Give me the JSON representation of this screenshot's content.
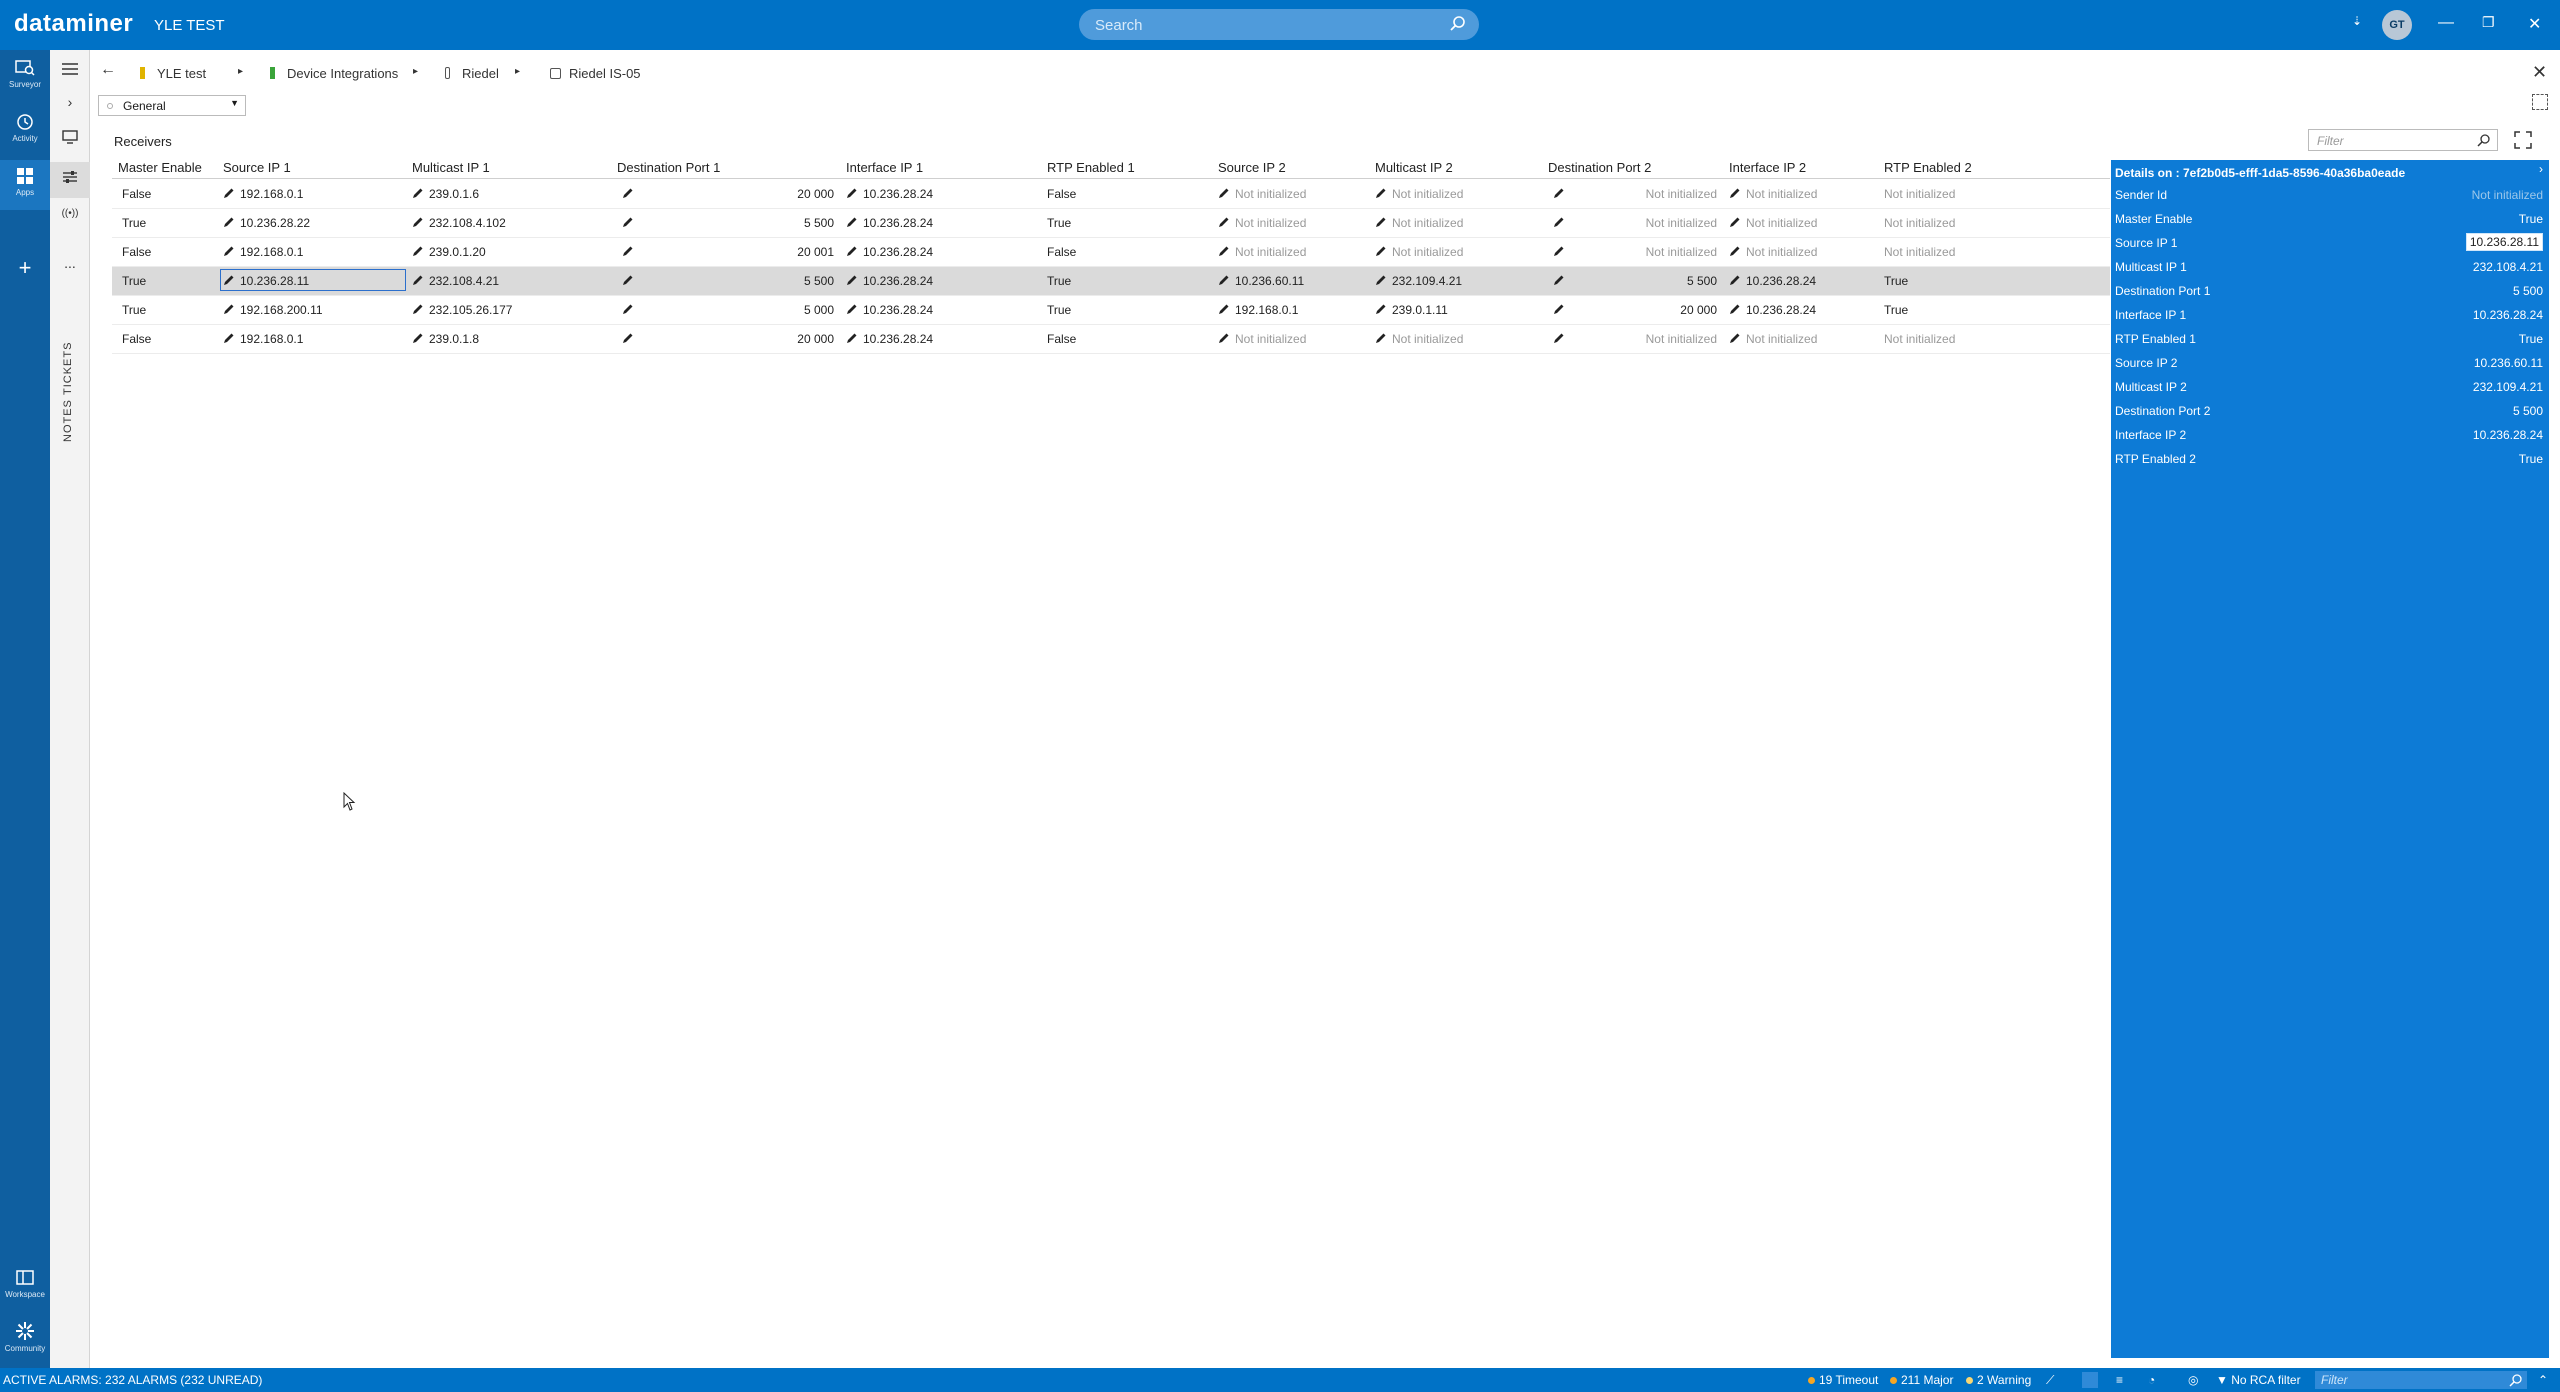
{
  "app": {
    "logo": "dataminer",
    "system_name": "YLE TEST",
    "search_placeholder": "Search",
    "avatar_initials": "GT",
    "accent_color": "#0072c6"
  },
  "nav": {
    "items": [
      {
        "label": "Surveyor",
        "icon": "surveyor-icon"
      },
      {
        "label": "Activity",
        "icon": "history-icon"
      },
      {
        "label": "Apps",
        "icon": "apps-icon"
      },
      {
        "label": "Workspace",
        "icon": "workspace-icon"
      },
      {
        "label": "Community",
        "icon": "community-icon"
      }
    ]
  },
  "side": {
    "tickets": "TICKETS",
    "notes": "NOTES",
    "more": "..."
  },
  "breadcrumb": [
    "YLE test",
    "Device Integrations",
    "Riedel",
    "Riedel IS-05"
  ],
  "page": {
    "view_selector": "General",
    "section_title": "Receivers",
    "filter_placeholder": "Filter"
  },
  "table": {
    "columns": [
      "Master Enable",
      "Source IP 1",
      "Multicast IP 1",
      "Destination Port 1",
      "Interface IP 1",
      "RTP Enabled 1",
      "Source IP 2",
      "Multicast IP 2",
      "Destination Port 2",
      "Interface IP 2",
      "RTP Enabled 2"
    ],
    "rows": [
      [
        "False",
        "192.168.0.1",
        "239.0.1.6",
        "20 000",
        "10.236.28.24",
        "False",
        "Not initialized",
        "Not initialized",
        "Not initialized",
        "Not initialized",
        "Not initialized"
      ],
      [
        "True",
        "10.236.28.22",
        "232.108.4.102",
        "5 500",
        "10.236.28.24",
        "True",
        "Not initialized",
        "Not initialized",
        "Not initialized",
        "Not initialized",
        "Not initialized"
      ],
      [
        "False",
        "192.168.0.1",
        "239.0.1.20",
        "20 001",
        "10.236.28.24",
        "False",
        "Not initialized",
        "Not initialized",
        "Not initialized",
        "Not initialized",
        "Not initialized"
      ],
      [
        "True",
        "10.236.28.11",
        "232.108.4.21",
        "5 500",
        "10.236.28.24",
        "True",
        "10.236.60.11",
        "232.109.4.21",
        "5 500",
        "10.236.28.24",
        "True"
      ],
      [
        "True",
        "192.168.200.11",
        "232.105.26.177",
        "5 000",
        "10.236.28.24",
        "True",
        "192.168.0.1",
        "239.0.1.11",
        "20 000",
        "10.236.28.24",
        "True"
      ],
      [
        "False",
        "192.168.0.1",
        "239.0.1.8",
        "20 000",
        "10.236.28.24",
        "False",
        "Not initialized",
        "Not initialized",
        "Not initialized",
        "Not initialized",
        "Not initialized"
      ]
    ],
    "selected_row": 3
  },
  "details": {
    "title": "Details on : 7ef2b0d5-efff-1da5-8596-40a36ba0eade",
    "fields": [
      {
        "key": "Sender Id",
        "value": "Not initialized"
      },
      {
        "key": "Master Enable",
        "value": "True"
      },
      {
        "key": "Source IP 1",
        "value": "10.236.28.11"
      },
      {
        "key": "Multicast IP 1",
        "value": "232.108.4.21"
      },
      {
        "key": "Destination Port 1",
        "value": "5 500"
      },
      {
        "key": "Interface IP 1",
        "value": "10.236.28.24"
      },
      {
        "key": "RTP Enabled 1",
        "value": "True"
      },
      {
        "key": "Source IP 2",
        "value": "10.236.60.11"
      },
      {
        "key": "Multicast IP 2",
        "value": "232.109.4.21"
      },
      {
        "key": "Destination Port 2",
        "value": "5 500"
      },
      {
        "key": "Interface IP 2",
        "value": "10.236.28.24"
      },
      {
        "key": "RTP Enabled 2",
        "value": "True"
      }
    ]
  },
  "status": {
    "alarms": "ACTIVE ALARMS: 232 ALARMS (232 UNREAD)",
    "timeout": "19 Timeout",
    "major": "211 Major",
    "warning": "2 Warning",
    "rca": "No RCA filter",
    "filter_placeholder": "Filter",
    "colors": {
      "timeout": "#f5a623",
      "major": "#f5a623",
      "warning": "#f7d774"
    }
  }
}
